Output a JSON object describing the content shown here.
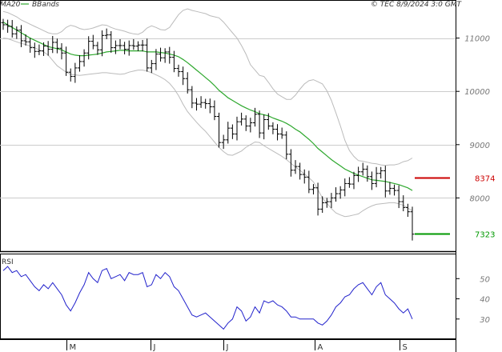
{
  "header": {
    "legend_ma": "MA20",
    "legend_bb": "BBands",
    "copyright": "© TEC 8/9/2024 3:0 GMT"
  },
  "colors": {
    "price": "#000000",
    "ma": "#2ea82e",
    "bbands": "#bbbbbb",
    "resistance": "#cc0000",
    "support": "#009900",
    "rsi": "#2222cc",
    "grid": "#cccccc"
  },
  "chart_data": [
    {
      "type": "ohlc",
      "panel": "price",
      "x_ticks": [
        "M",
        "J",
        "J",
        "A",
        "S"
      ],
      "y_ticks": [
        8000,
        9000,
        10000,
        11000
      ],
      "y_tick_labels": [
        "8000",
        "9000",
        "10000",
        "11000"
      ],
      "ylim": [
        7000,
        11700
      ],
      "closes": [
        11250,
        11220,
        11080,
        11150,
        10950,
        10930,
        10820,
        10750,
        10760,
        10850,
        10790,
        10920,
        10810,
        10720,
        10360,
        10280,
        10440,
        10560,
        10720,
        10940,
        10860,
        10780,
        11050,
        11060,
        10820,
        10860,
        10860,
        10790,
        10860,
        10850,
        10870,
        10870,
        10440,
        10520,
        10700,
        10630,
        10740,
        10640,
        10430,
        10370,
        10240,
        10030,
        9780,
        9760,
        9790,
        9770,
        9710,
        9530,
        9040,
        9090,
        9310,
        9200,
        9430,
        9480,
        9350,
        9410,
        9570,
        9220,
        9470,
        9350,
        9290,
        9200,
        9180,
        8820,
        8520,
        8590,
        8440,
        8390,
        8160,
        8190,
        7790,
        7910,
        7930,
        8000,
        8080,
        8150,
        8270,
        8260,
        8420,
        8490,
        8540,
        8400,
        8270,
        8460,
        8510,
        8130,
        8180,
        8140,
        7930,
        7820,
        7740,
        7320
      ],
      "ma20": [
        11300,
        11250,
        11200,
        11150,
        11100,
        11050,
        11000,
        10960,
        10920,
        10880,
        10840,
        10820,
        10800,
        10780,
        10740,
        10700,
        10680,
        10670,
        10670,
        10680,
        10690,
        10700,
        10720,
        10740,
        10750,
        10760,
        10770,
        10770,
        10760,
        10760,
        10760,
        10760,
        10740,
        10740,
        10740,
        10730,
        10720,
        10700,
        10680,
        10650,
        10600,
        10540,
        10470,
        10400,
        10330,
        10260,
        10190,
        10110,
        10020,
        9950,
        9880,
        9830,
        9780,
        9730,
        9690,
        9650,
        9620,
        9580,
        9560,
        9540,
        9500,
        9470,
        9440,
        9400,
        9350,
        9290,
        9240,
        9170,
        9100,
        9020,
        8930,
        8860,
        8790,
        8720,
        8660,
        8600,
        8540,
        8500,
        8460,
        8430,
        8400,
        8370,
        8340,
        8330,
        8320,
        8310,
        8290,
        8270,
        8250,
        8220,
        8190,
        8140
      ],
      "bb_upper": [
        11500,
        11480,
        11440,
        11400,
        11340,
        11300,
        11260,
        11220,
        11180,
        11140,
        11100,
        11080,
        11080,
        11120,
        11200,
        11240,
        11220,
        11180,
        11160,
        11170,
        11190,
        11220,
        11250,
        11240,
        11200,
        11170,
        11150,
        11130,
        11100,
        11080,
        11070,
        11110,
        11190,
        11230,
        11200,
        11160,
        11150,
        11200,
        11320,
        11440,
        11520,
        11550,
        11520,
        11500,
        11480,
        11460,
        11420,
        11400,
        11380,
        11300,
        11200,
        11100,
        11000,
        10860,
        10700,
        10500,
        10400,
        10300,
        10280,
        10170,
        10050,
        9950,
        9900,
        9850,
        9850,
        9930,
        10040,
        10140,
        10200,
        10220,
        10180,
        10140,
        10010,
        9830,
        9600,
        9350,
        9080,
        8890,
        8780,
        8700,
        8690,
        8670,
        8650,
        8640,
        8620,
        8610,
        8620,
        8620,
        8640,
        8680,
        8700,
        8750
      ],
      "bb_lower": [
        11000,
        10990,
        10960,
        10930,
        10900,
        10880,
        10850,
        10820,
        10780,
        10740,
        10680,
        10580,
        10480,
        10420,
        10360,
        10320,
        10310,
        10300,
        10310,
        10320,
        10330,
        10340,
        10350,
        10350,
        10340,
        10330,
        10320,
        10330,
        10360,
        10380,
        10400,
        10400,
        10380,
        10350,
        10310,
        10270,
        10220,
        10150,
        10050,
        9920,
        9760,
        9620,
        9520,
        9420,
        9330,
        9250,
        9150,
        9050,
        8950,
        8870,
        8810,
        8800,
        8840,
        8880,
        8950,
        9000,
        9050,
        9040,
        8980,
        8930,
        8880,
        8830,
        8780,
        8720,
        8650,
        8580,
        8520,
        8450,
        8380,
        8300,
        8150,
        8000,
        7900,
        7800,
        7720,
        7680,
        7650,
        7660,
        7680,
        7700,
        7760,
        7810,
        7850,
        7880,
        7890,
        7900,
        7910,
        7910,
        7890,
        7860,
        7810,
        7760
      ],
      "levels": [
        {
          "name": "resistance",
          "value": 8374,
          "label": "8374"
        },
        {
          "name": "support",
          "value": 7323,
          "label": "7323"
        }
      ]
    },
    {
      "type": "line",
      "panel": "rsi",
      "title": "RSI",
      "y_ticks": [
        30,
        40,
        50
      ],
      "y_tick_labels": [
        "30",
        "40",
        "50"
      ],
      "ylim": [
        20,
        62
      ],
      "values": [
        54,
        56,
        53,
        54,
        51,
        52,
        49,
        46,
        44,
        47,
        45,
        48,
        45,
        42,
        37,
        34,
        38,
        43,
        47,
        53,
        50,
        48,
        54,
        55,
        50,
        51,
        52,
        49,
        53,
        52,
        52,
        53,
        46,
        47,
        52,
        50,
        53,
        51,
        46,
        44,
        40,
        36,
        32,
        31,
        32,
        33,
        31,
        29,
        27,
        25,
        28,
        30,
        36,
        34,
        29,
        31,
        36,
        33,
        39,
        38,
        39,
        37,
        36,
        34,
        31,
        31,
        30,
        30,
        30,
        30,
        28,
        27,
        29,
        32,
        36,
        38,
        41,
        42,
        45,
        47,
        48,
        45,
        42,
        46,
        48,
        42,
        40,
        38,
        35,
        33,
        35,
        30
      ]
    }
  ]
}
